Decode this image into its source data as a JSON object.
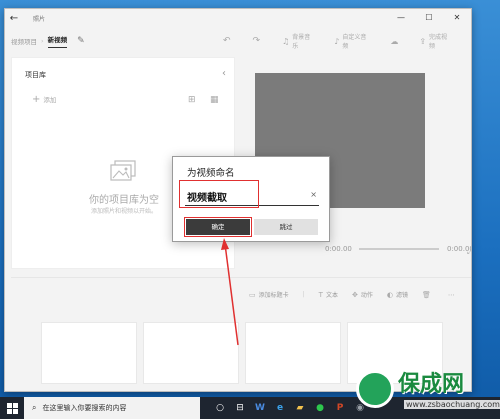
{
  "app": {
    "title": "照片"
  },
  "window_controls": {
    "minimize": "—",
    "maximize": "☐",
    "close": "✕"
  },
  "toolbar": {
    "back": "←",
    "breadcrumb_parent": "视频项目",
    "breadcrumb_current": "新视频",
    "items": [
      {
        "label": "背景音乐"
      },
      {
        "label": "自定义音频"
      },
      {
        "label": "完成视频"
      }
    ]
  },
  "library": {
    "title": "项目库",
    "add_label": "添加",
    "empty_title": "你的项目库为空",
    "empty_hint": "添加照片和视频以开始。"
  },
  "preview": {
    "time_start": "0:00.00",
    "time_end": "0:00.00"
  },
  "storyboard": {
    "toolbar": [
      {
        "label": "添加标题卡"
      },
      {
        "label": "文本"
      },
      {
        "label": "动作"
      },
      {
        "label": "滤镜"
      }
    ]
  },
  "dialog": {
    "title": "为视频命名",
    "input_value": "视频截取",
    "clear": "×",
    "ok_label": "确定",
    "skip_label": "跳过"
  },
  "taskbar": {
    "search_placeholder": "在这里输入你要搜索的内容"
  },
  "watermark": {
    "main": "保成网",
    "url": "www.zsbaochuang.com"
  },
  "colors": {
    "highlight": "#e03030",
    "ok_button": "#3b3b3b",
    "preview_bg": "#7b7b7b"
  }
}
